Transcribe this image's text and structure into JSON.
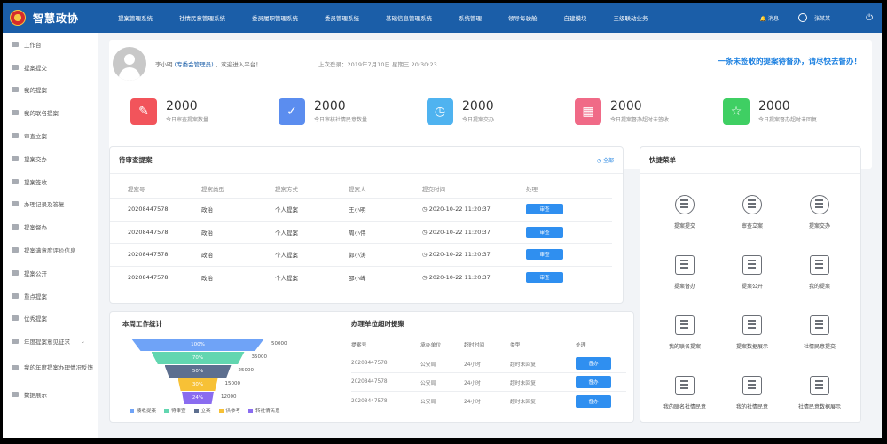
{
  "app": {
    "brand": "智慧政协"
  },
  "nav": {
    "items": [
      "提案管理系统",
      "社情民意管理系统",
      "委员履职管理系统",
      "委员管理系统",
      "基础信息管理系统",
      "系统管理",
      "领导每驶舱",
      "自建模块",
      "三级联动业务"
    ],
    "message_label": "消息",
    "user_name": "张某某"
  },
  "sidebar": {
    "items": [
      {
        "label": "工作台"
      },
      {
        "label": "提案提交"
      },
      {
        "label": "我的提案"
      },
      {
        "label": "我的联名提案"
      },
      {
        "label": "审查立案"
      },
      {
        "label": "提案交办"
      },
      {
        "label": "提案签收"
      },
      {
        "label": "办理记录及答复"
      },
      {
        "label": "提案督办"
      },
      {
        "label": "提案满意度评价信息"
      },
      {
        "label": "提案公开"
      },
      {
        "label": "重点提案"
      },
      {
        "label": "优秀提案"
      },
      {
        "label": "年度提案意见征求"
      },
      {
        "label": "我的年度提案办理情况反馈"
      },
      {
        "label": "数据展示"
      }
    ]
  },
  "welcome": {
    "user": "李小明",
    "role": "(专委会管理员)",
    "suffix": "，欢迎进入平台！",
    "last_login": "上次登录：2019年7月10日 星期三 20:30:23",
    "notice": "一条未签收的提案待督办，请尽快去督办！"
  },
  "stats": [
    {
      "value": "2000",
      "label": "今日审查提案数量",
      "color": "#f2545b",
      "icon": "edit-icon"
    },
    {
      "value": "2000",
      "label": "今日审核社情民意数量",
      "color": "#5b8def",
      "icon": "check-doc-icon"
    },
    {
      "value": "2000",
      "label": "今日提案交办",
      "color": "#4fb3f0",
      "icon": "clock-doc-icon"
    },
    {
      "value": "2000",
      "label": "今日提案督办超时未签收",
      "color": "#f06a87",
      "icon": "calendar-icon"
    },
    {
      "value": "2000",
      "label": "今日提案督办超时未回复",
      "color": "#3fcf63",
      "icon": "star-icon"
    }
  ],
  "pending": {
    "title": "待审查提案",
    "all_label": "全部",
    "columns": [
      "提案号",
      "提案类型",
      "提案方式",
      "提案人",
      "提交时间",
      "处理"
    ],
    "rows": [
      {
        "no": "20208447578",
        "type": "政治",
        "way": "个人提案",
        "person": "王小明",
        "time": "2020-10-22 11:20:37",
        "action": "审查"
      },
      {
        "no": "20208447578",
        "type": "政治",
        "way": "个人提案",
        "person": "周小伟",
        "time": "2020-10-22 11:20:37",
        "action": "审查"
      },
      {
        "no": "20208447578",
        "type": "政治",
        "way": "个人提案",
        "person": "郭小涛",
        "time": "2020-10-22 11:20:37",
        "action": "审查"
      },
      {
        "no": "20208447578",
        "type": "政治",
        "way": "个人提案",
        "person": "邵小峰",
        "time": "2020-10-22 11:20:37",
        "action": "审查"
      }
    ]
  },
  "quick": {
    "title": "快捷菜单",
    "items": [
      {
        "label": "提案提交",
        "icon": "user-icon"
      },
      {
        "label": "审查立案",
        "icon": "bulb-icon"
      },
      {
        "label": "提案交办",
        "icon": "money-hand-icon"
      },
      {
        "label": "提案督办",
        "icon": "portrait-icon"
      },
      {
        "label": "提案公开",
        "icon": "doc-edit-icon"
      },
      {
        "label": "我的提案",
        "icon": "doc-icon"
      },
      {
        "label": "我的联名提案",
        "icon": "receipt-icon"
      },
      {
        "label": "提案数据展示",
        "icon": "dollar-doc-icon"
      },
      {
        "label": "社情民意提交",
        "icon": "yen-ticket-icon"
      },
      {
        "label": "我的联名社情民意",
        "icon": "clipboard-icon"
      },
      {
        "label": "我的社情民意",
        "icon": "clipboard-icon"
      },
      {
        "label": "社情民意数据展示",
        "icon": "clipboard-icon"
      }
    ]
  },
  "weekly": {
    "title": "本周工作统计",
    "chart_data": {
      "type": "funnel",
      "series": [
        {
          "name": "接收提案",
          "value": 50000,
          "pct": "100%",
          "color": "#6fa3f7"
        },
        {
          "name": "待审查",
          "value": 35000,
          "pct": "70%",
          "color": "#62d6b0"
        },
        {
          "name": "立案",
          "value": 25000,
          "pct": "50%",
          "color": "#5d6f8f"
        },
        {
          "name": "供参考",
          "value": 15000,
          "pct": "30%",
          "color": "#f7c136"
        },
        {
          "name": "转社情民意",
          "value": 12000,
          "pct": "24%",
          "color": "#8a6cf0"
        }
      ]
    }
  },
  "overtime": {
    "title": "办理单位超时提案",
    "columns": [
      "提案号",
      "承办单位",
      "超时时间",
      "类型",
      "处理"
    ],
    "rows": [
      {
        "no": "20208447578",
        "unit": "公安局",
        "time": "24小时",
        "type": "超时未回复",
        "action": "督办"
      },
      {
        "no": "20208447578",
        "unit": "公安局",
        "time": "24小时",
        "type": "超时未回复",
        "action": "督办"
      },
      {
        "no": "20208447578",
        "unit": "公安局",
        "time": "24小时",
        "type": "超时未回复",
        "action": "督办"
      }
    ]
  }
}
